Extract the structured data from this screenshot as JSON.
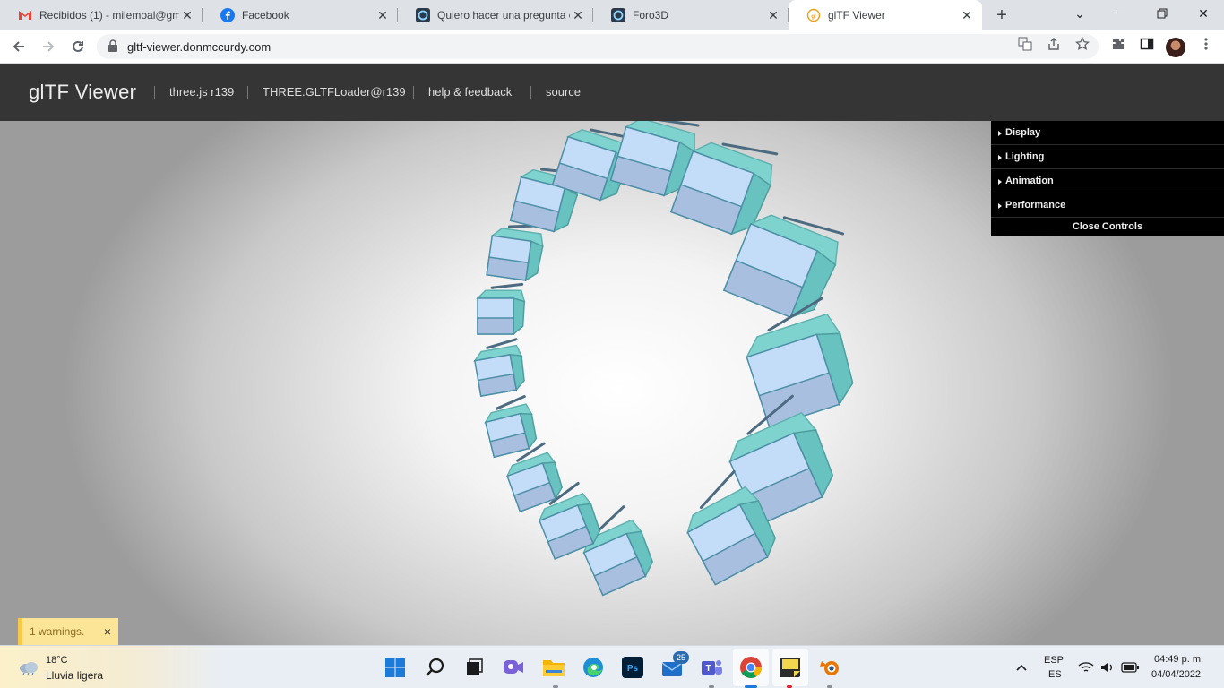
{
  "browser": {
    "tabs": [
      {
        "title": "Recibidos (1) - milemoal@gm",
        "favicon": "gmail-icon"
      },
      {
        "title": "Facebook",
        "favicon": "facebook-icon"
      },
      {
        "title": "Quiero hacer una pregunta e",
        "favicon": "foro3d-icon"
      },
      {
        "title": "Foro3D",
        "favicon": "foro3d-icon"
      },
      {
        "title": "glTF Viewer",
        "favicon": "gltf-icon",
        "active": true
      }
    ],
    "new_tab": "+",
    "url": "gltf-viewer.donmccurdy.com"
  },
  "header": {
    "title": "glTF Viewer",
    "links": [
      "three.js r139",
      "THREE.GLTFLoader@r139",
      "help & feedback",
      "source"
    ]
  },
  "controls": {
    "folders": [
      "Display",
      "Lighting",
      "Animation",
      "Performance"
    ],
    "close_label": "Close Controls"
  },
  "toast": {
    "message": "1 warnings.",
    "close": "×"
  },
  "taskbar": {
    "weather_temp": "18°C",
    "weather_desc": "Lluvia ligera",
    "mail_badge": "25",
    "lang_top": "ESP",
    "lang_bottom": "ES",
    "time": "04:49 p. m.",
    "date": "04/04/2022"
  },
  "colors": {
    "header_bg": "#353535",
    "gui_bg": "#000000",
    "cube_top": "#7fd3cf",
    "cube_face": "#c3dcf7",
    "toast_bg": "#fde598"
  }
}
